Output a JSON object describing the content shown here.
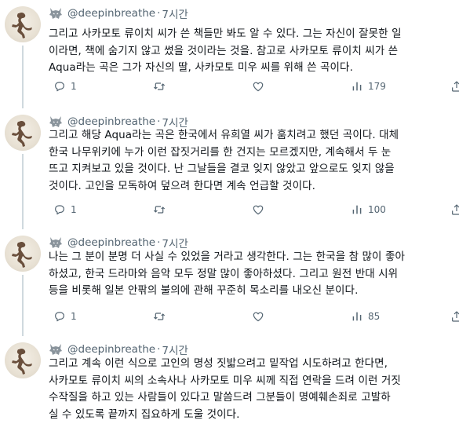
{
  "tweets": [
    {
      "handle": "@deepinbreathe",
      "separator": "·",
      "time": "7시간",
      "lines": [
        "그리고 사카모토 류이치 씨가 쓴 책들만 봐도 알 수 있다. 그는 자신이 잘못한 일",
        "이라면, 책에 숨기지 않고 썼을 것이라는 것을. 참고로 사카모토 류이치 씨가 쓴",
        "Aqua라는 곡은 그가 자신의 딸, 사카모토 미우 씨를 위해 쓴 곡이다."
      ],
      "replies": "1",
      "retweets": "",
      "likes": "",
      "views": "179"
    },
    {
      "handle": "@deepinbreathe",
      "separator": "·",
      "time": "7시간",
      "lines": [
        "그리고 해당 Aqua라는 곡은 한국에서 유희열 씨가 훔치려고 했던 곡이다. 대체",
        "한국 나무위키에 누가 이런 잡짓거리를 한 건지는 모르겠지만, 계속해서 두 눈",
        "뜨고 지켜보고 있을 것이다. 난 그날들을 결코 잊지 않았고 앞으로도 잊지 않을",
        "것이다. 고인을 모독하여 덮으려 한다면 계속 언급할 것이다."
      ],
      "replies": "1",
      "retweets": "",
      "likes": "",
      "views": "100"
    },
    {
      "handle": "@deepinbreathe",
      "separator": "·",
      "time": "7시간",
      "lines": [
        "나는 그 분이 분명 더 사실 수 있었을 거라고 생각한다. 그는 한국을 참 많이 좋아",
        "하셨고, 한국 드라마와 음악 모두 정말 많이 좋아하셨다. 그리고 원전 반대 시위",
        "등을 비롯해 일본 안팎의 불의에 관해 꾸준히 목소리를 내오신 분이다."
      ],
      "replies": "1",
      "retweets": "",
      "likes": "",
      "views": "85"
    },
    {
      "handle": "@deepinbreathe",
      "separator": "·",
      "time": "7시간",
      "lines": [
        "그리고 계속 이런 식으로 고인의 명성 짓밟으려고 밑작업 시도하려고 한다면,",
        "사카모토 류이치 씨의 소속사나 사카모토 미우 씨께 직접 연락을 드려 이런 거짓",
        "수작질을 하고 있는 사람들이 있다고 말씀드려 그분들이 명예훼손죄로 고발하",
        "실 수 있도록 끝까지 집요하게 도울 것이다."
      ],
      "replies": "",
      "retweets": "",
      "likes": "",
      "views": ""
    }
  ],
  "colors": {
    "muted": "#536471",
    "text": "#0f1419",
    "thread": "#cfd9de"
  },
  "icons": [
    "avatar-image",
    "brand-wolf-icon",
    "reply-icon",
    "retweet-icon",
    "like-icon",
    "views-icon",
    "share-icon"
  ]
}
